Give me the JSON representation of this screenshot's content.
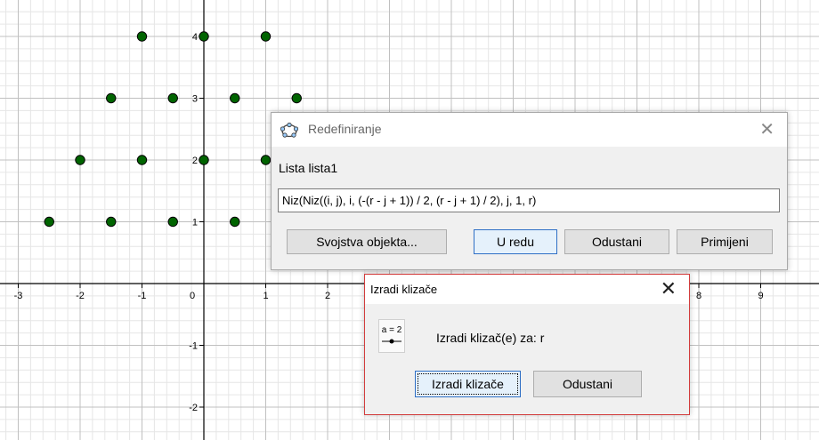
{
  "graphics": {
    "x_ticks": [
      "-3",
      "-2",
      "-1",
      "0",
      "1",
      "2",
      "8",
      "9"
    ],
    "y_ticks": [
      "4",
      "3",
      "2",
      "1",
      "-1",
      "-2"
    ],
    "point_color": "#006400",
    "points": [
      [
        -1,
        4
      ],
      [
        0,
        4
      ],
      [
        1,
        4
      ],
      [
        -1.5,
        3
      ],
      [
        -0.5,
        3
      ],
      [
        0.5,
        3
      ],
      [
        1.5,
        3
      ],
      [
        -2,
        2
      ],
      [
        -1,
        2
      ],
      [
        0,
        2
      ],
      [
        1,
        2
      ],
      [
        -2.5,
        1
      ],
      [
        -1.5,
        1
      ],
      [
        -0.5,
        1
      ],
      [
        0.5,
        1
      ]
    ]
  },
  "redefine_dialog": {
    "title": "Redefiniranje",
    "object_label": "Lista lista1",
    "command": "Niz(Niz((i, j), i, (-(r - j + 1)) / 2, (r - j + 1) / 2), j, 1, r)",
    "buttons": {
      "properties": "Svojstva objekta...",
      "ok": "U redu",
      "cancel": "Odustani",
      "apply": "Primijeni"
    },
    "close_glyph": "✕",
    "icon": "geogebra-logo-icon"
  },
  "slider_dialog": {
    "title": "Izradi klizače",
    "icon_text": "a = 2",
    "message": "Izradi klizač(e) za: r",
    "buttons": {
      "create": "Izradi klizače",
      "cancel": "Odustani"
    },
    "close_glyph": "✕",
    "accent_color": "#d23c3c"
  }
}
